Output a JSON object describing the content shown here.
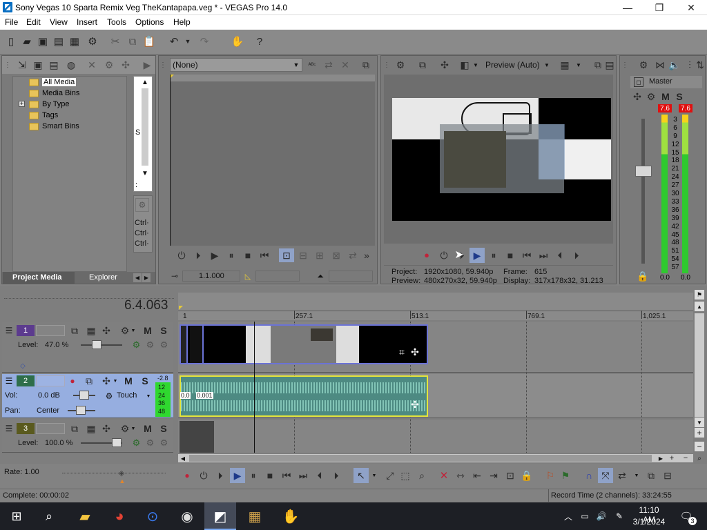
{
  "window": {
    "title": "Sony Vegas 10 Sparta Remix Veg TheKantapapa.veg * - VEGAS Pro 14.0",
    "minimize": "—",
    "maximize": "❐",
    "close": "✕"
  },
  "menu": [
    "File",
    "Edit",
    "View",
    "Insert",
    "Tools",
    "Options",
    "Help"
  ],
  "project_media": {
    "tree": [
      "All Media",
      "Media Bins",
      "By Type",
      "Tags",
      "Smart Bins"
    ],
    "tree_expander": "+",
    "tabs": [
      "Project Media",
      "Explorer"
    ],
    "side_labels": [
      "S",
      ":"
    ],
    "ctrl_labels": [
      "Ctrl·",
      "Ctrl·",
      "Ctrl·"
    ]
  },
  "trimmer": {
    "select_value": "(None)",
    "timecode": "1.1.000"
  },
  "preview": {
    "mode": "Preview (Auto)",
    "project_label": "Project:",
    "project_value": "1920x1080, 59.940p",
    "preview_label": "Preview:",
    "preview_value": "480x270x32, 59.940p",
    "frame_label": "Frame:",
    "frame_value": "615",
    "display_label": "Display:",
    "display_value": "317x178x32, 31.213"
  },
  "master": {
    "title": "Master",
    "peak_left": "7.6",
    "peak_right": "7.6",
    "scale": [
      "3",
      "6",
      "9",
      "12",
      "15",
      "18",
      "21",
      "24",
      "27",
      "30",
      "33",
      "36",
      "39",
      "42",
      "45",
      "48",
      "51",
      "54",
      "57"
    ],
    "bottom_left": "0.0",
    "bottom_right": "0.0",
    "m_label": "M",
    "s_label": "S"
  },
  "timeline": {
    "cursor_time": "6.4.063",
    "ruler": [
      "1",
      "257.1",
      "513.1",
      "769.1",
      "1,025.1"
    ],
    "tracks": [
      {
        "num": "1",
        "level_label": "Level:",
        "level_value": "47.0 %"
      },
      {
        "num": "2",
        "vol_label": "Vol:",
        "vol_value": "0.0 dB",
        "pan_label": "Pan:",
        "pan_value": "Center",
        "automation": "Touch",
        "meter_top": "-2.8",
        "meter_values": [
          "12",
          "24",
          "36",
          "48"
        ],
        "clip_vals": [
          "0.0",
          "0.001"
        ]
      },
      {
        "num": "3",
        "level_label": "Level:",
        "level_value": "100.0 %"
      }
    ],
    "m_label": "M",
    "s_label": "S"
  },
  "transport": {
    "rate": "Rate: 1.00"
  },
  "status": {
    "complete": "Complete: 00:00:02",
    "record_time": "Record Time (2 channels): 33:24:55"
  },
  "taskbar": {
    "time": "11:10 AM",
    "date": "3/1/2024",
    "notification_count": "3"
  }
}
